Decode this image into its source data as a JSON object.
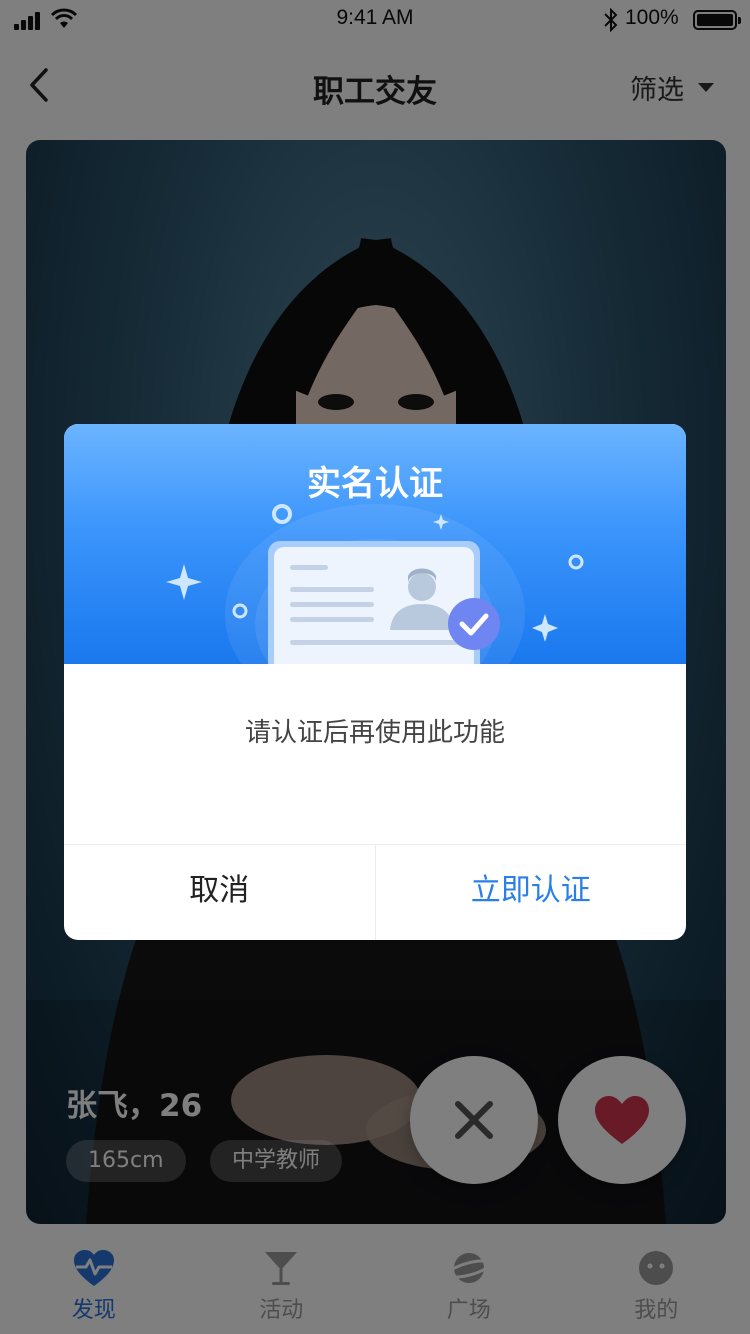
{
  "status_bar": {
    "time": "9:41 AM",
    "battery": "100%",
    "battery_level": 1.0
  },
  "nav": {
    "title": "职工交友",
    "filter_label": "筛选"
  },
  "profile": {
    "name_age": "张飞，26",
    "tags": [
      "165cm",
      "中学教师"
    ]
  },
  "tabs": [
    {
      "label": "发现",
      "icon": "heartbeat-icon",
      "active": true
    },
    {
      "label": "活动",
      "icon": "cocktail-icon",
      "active": false
    },
    {
      "label": "广场",
      "icon": "planet-icon",
      "active": false
    },
    {
      "label": "我的",
      "icon": "smiley-icon",
      "active": false
    }
  ],
  "modal": {
    "title": "实名认证",
    "message": "请认证后再使用此功能",
    "cancel_label": "取消",
    "confirm_label": "立即认证"
  },
  "colors": {
    "accent": "#2a80e8",
    "modal_header_top": "#6bb4ff",
    "modal_header_bottom": "#1a78ee",
    "like": "#d2344e"
  }
}
